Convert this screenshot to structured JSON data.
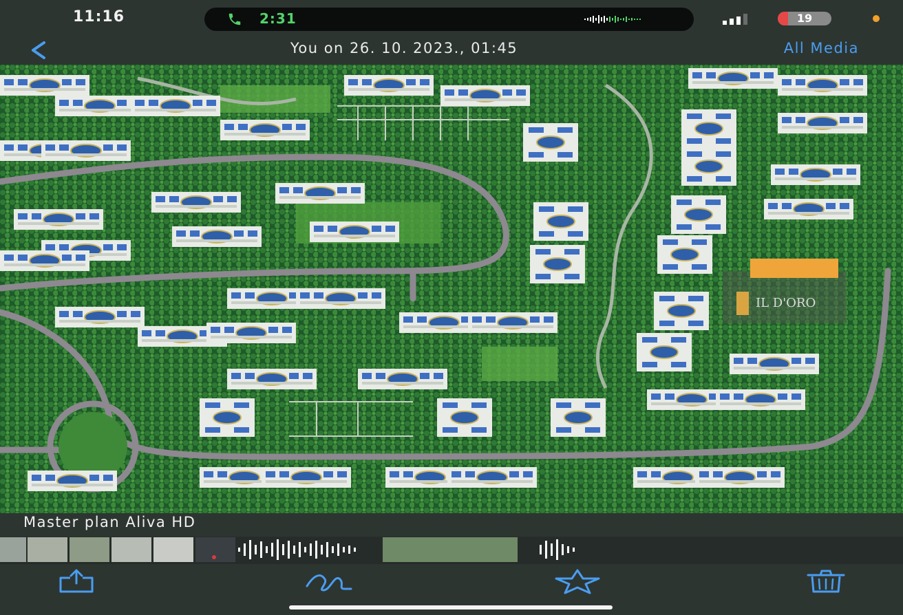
{
  "status_bar": {
    "time": "11:16",
    "call_duration": "2:31",
    "battery_level": "19",
    "battery_fraction": 0.19,
    "call_color": "#53d36a",
    "battery_color": "#e54846"
  },
  "nav": {
    "back_icon": "chevron-left-icon",
    "title": "You on 26. 10. 2023., 01:45",
    "all_media_label": "All Media",
    "accent_color": "#4a9df0"
  },
  "media": {
    "image_description_icon": "masterplan-image",
    "watermark_text": "IL D'ORO",
    "caption": "Master plan Aliva  HD"
  },
  "thumbnails": {
    "items": [
      "image",
      "image",
      "image",
      "image",
      "image",
      "video",
      "audio",
      "image",
      "audio"
    ]
  },
  "toolbar": {
    "share_icon": "share-icon",
    "markup_icon": "markup-icon",
    "star_icon": "star-icon",
    "delete_icon": "trash-icon"
  }
}
